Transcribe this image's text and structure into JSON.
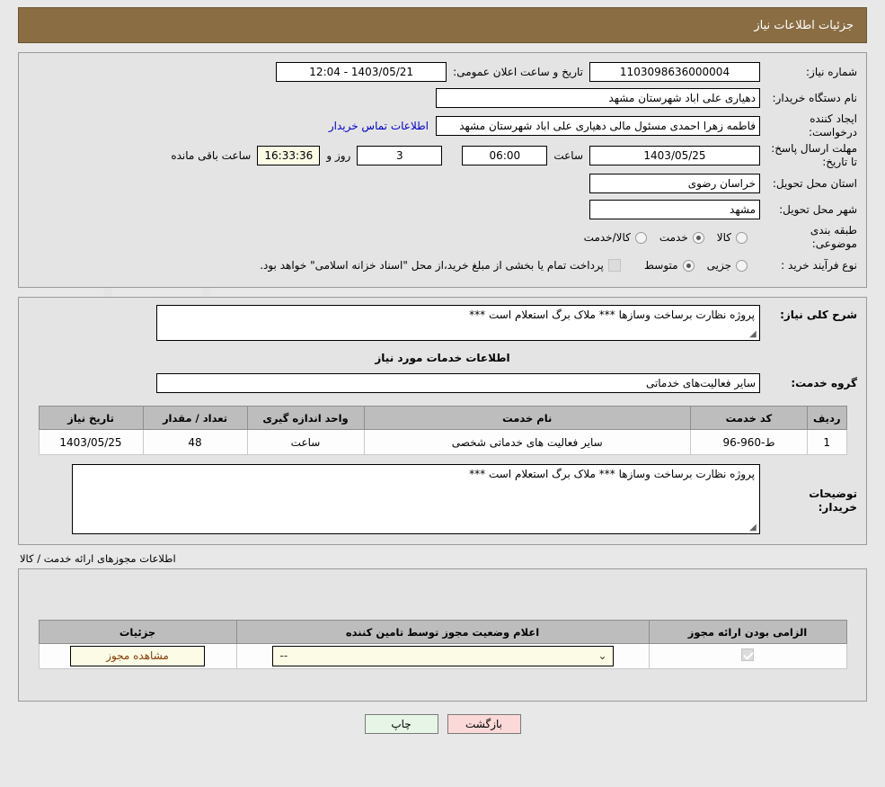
{
  "header": {
    "title": "جزئیات اطلاعات نیاز"
  },
  "form": {
    "need_number_label": "شماره نیاز:",
    "need_number_value": "1103098636000004",
    "announce_label": "تاریخ و ساعت اعلان عمومی:",
    "announce_value": "1403/05/21 - 12:04",
    "buyer_org_label": "نام دستگاه خریدار:",
    "buyer_org_value": "دهیاری علی اباد شهرستان مشهد",
    "creator_label": "ایجاد کننده درخواست:",
    "creator_value": "فاطمه زهرا احمدی مسئول مالی دهیاری علی اباد شهرستان مشهد",
    "contact_link": "اطلاعات تماس خریدار",
    "deadline_label": "مهلت ارسال پاسخ: تا تاریخ:",
    "deadline_date": "1403/05/25",
    "hour_label": "ساعت",
    "deadline_time": "06:00",
    "days_remaining": "3",
    "days_text": "روز و",
    "time_remaining": "16:33:36",
    "remaining_suffix": "ساعت باقی مانده",
    "province_label": "استان محل تحویل:",
    "province_value": "خراسان رضوی",
    "city_label": "شهر محل تحویل:",
    "city_value": "مشهد",
    "category_label": "طبقه بندی موضوعی:",
    "category_options": [
      {
        "label": "کالا",
        "selected": false
      },
      {
        "label": "خدمت",
        "selected": true
      },
      {
        "label": "کالا/خدمت",
        "selected": false
      }
    ],
    "process_label": "نوع فرآیند خرید :",
    "process_options": [
      {
        "label": "جزیی",
        "selected": false
      },
      {
        "label": "متوسط",
        "selected": true
      }
    ],
    "treasury_checkbox_checked": false,
    "treasury_note": "پرداخت تمام یا بخشی از مبلغ خرید،از محل \"اسناد خزانه اسلامی\" خواهد بود."
  },
  "description": {
    "label": "شرح کلی نیاز:",
    "value": "پروژه نظارت برساخت وسازها *** ملاک برگ استعلام است ***"
  },
  "services": {
    "section_title": "اطلاعات خدمات مورد نیاز",
    "group_label": "گروه خدمت:",
    "group_value": "سایر فعالیت‌های خدماتی",
    "columns": [
      "ردیف",
      "کد خدمت",
      "نام خدمت",
      "واحد اندازه گیری",
      "تعداد / مقدار",
      "تاریخ نیاز"
    ],
    "rows": [
      [
        "1",
        "ط-960-96",
        "سایر فعالیت های خدماتی شخصی",
        "ساعت",
        "48",
        "1403/05/25"
      ]
    ]
  },
  "buyer_notes": {
    "label": "توضیحات خریدار:",
    "value": "پروژه نظارت برساخت وسازها *** ملاک برگ استعلام است ***"
  },
  "licenses": {
    "title": "اطلاعات مجوزهای ارائه خدمت / کالا",
    "columns": [
      "الزامی بودن ارائه مجوز",
      "اعلام وضعیت مجوز توسط تامین کننده",
      "جزئیات"
    ],
    "rows": [
      {
        "required_checked": true,
        "status_value": "--",
        "details_button": "مشاهده مجوز"
      }
    ]
  },
  "footer": {
    "print_label": "چاپ",
    "back_label": "بازگشت"
  },
  "watermark": {
    "text": "AriaTender.net"
  },
  "colors": {
    "banner": "#8a6d43",
    "link": "#0000cc",
    "print": "#e6f5e6",
    "back": "#fbd9d9",
    "field_yellow": "#fbfbe6"
  }
}
